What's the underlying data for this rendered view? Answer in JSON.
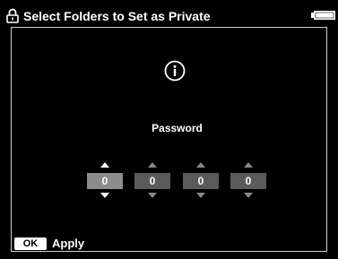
{
  "header": {
    "title": "Select Folders to Set as Private",
    "left_icon": "lock-icon",
    "right_icon": "battery-icon"
  },
  "dialog": {
    "icon": "info-icon",
    "label": "Password",
    "digits": [
      {
        "value": "0",
        "active": true
      },
      {
        "value": "0",
        "active": false
      },
      {
        "value": "0",
        "active": false
      },
      {
        "value": "0",
        "active": false
      }
    ]
  },
  "footer": {
    "ok_key": "OK",
    "action_label": "Apply"
  },
  "colors": {
    "background": "#000000",
    "text": "#ffffff",
    "active_digit": "#8c8c8c",
    "inactive_digit": "#5a5a5a"
  }
}
